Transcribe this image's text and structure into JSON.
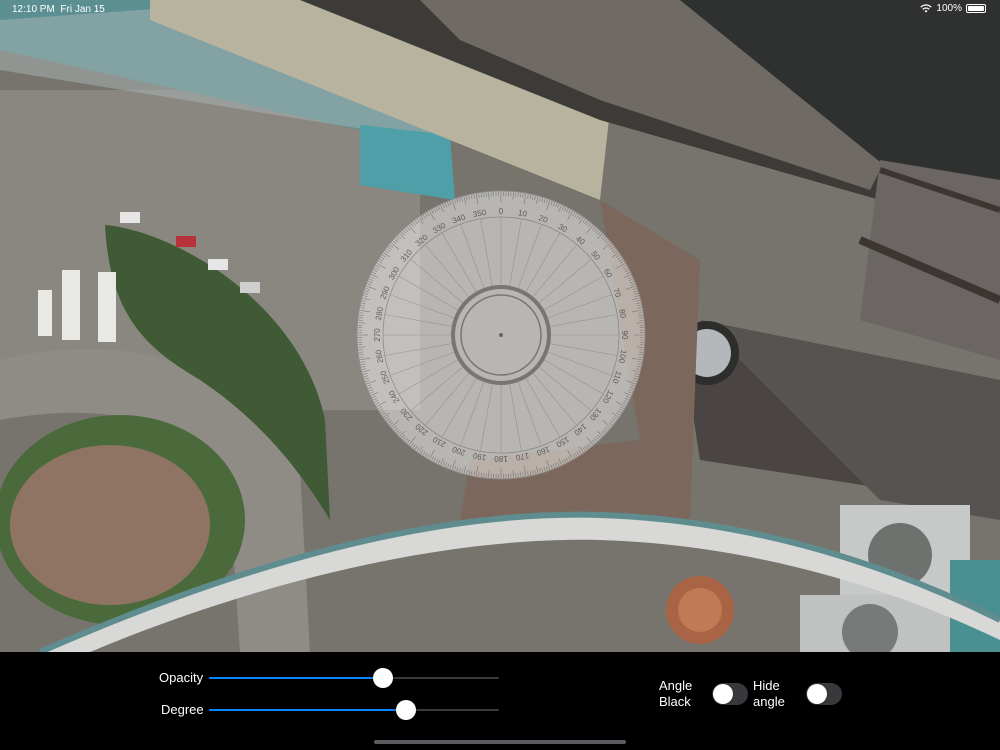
{
  "status_bar": {
    "time": "12:10 PM",
    "date": "Fri Jan 15",
    "battery": "100%",
    "wifi_icon": "wifi-icon",
    "battery_icon": "battery-icon"
  },
  "map": {
    "view": "satellite"
  },
  "protractor": {
    "rotation_degrees": 0,
    "opacity": 0.6,
    "tick_step": 10
  },
  "controls": {
    "opacity": {
      "label": "Opacity",
      "value": 0.6
    },
    "degree": {
      "label": "Degree",
      "value": 0.68
    },
    "angle_black": {
      "label_line1": "Angle",
      "label_line2": "Black",
      "on": false
    },
    "hide_angle": {
      "label_line1": "Hide",
      "label_line2": "angle",
      "on": false
    }
  },
  "colors": {
    "accent": "#0a84ff",
    "panel_background": "#000000",
    "toggle_off": "#39393d"
  }
}
